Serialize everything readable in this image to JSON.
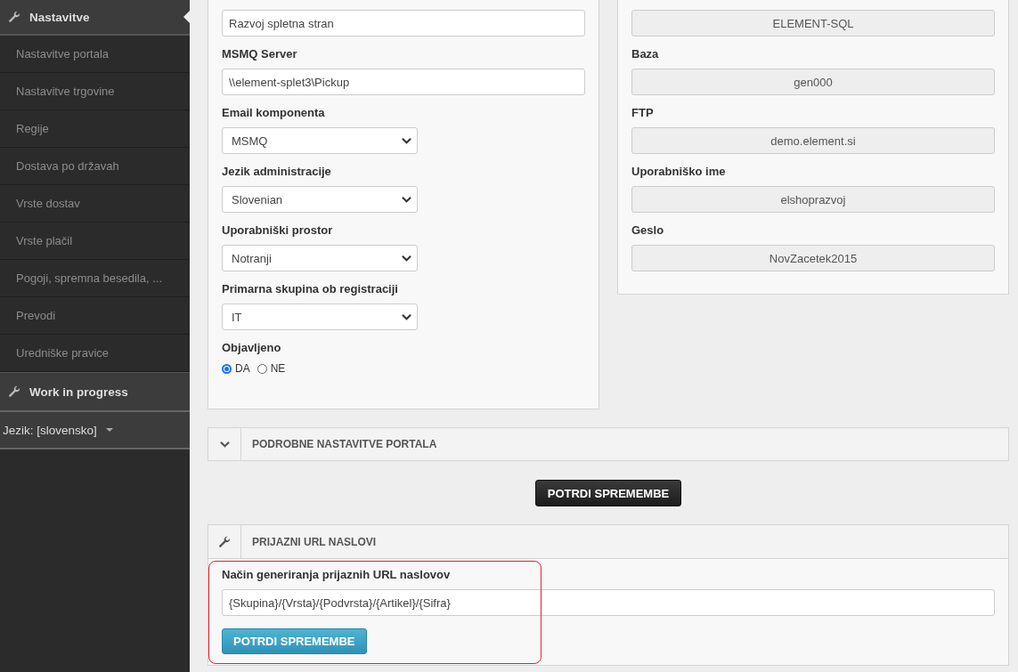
{
  "sidebar": {
    "header": {
      "label": "Nastavitve"
    },
    "items": [
      {
        "label": "Nastavitve portala"
      },
      {
        "label": "Nastavitve trgovine"
      },
      {
        "label": "Regije"
      },
      {
        "label": "Dostava po državah"
      },
      {
        "label": "Vrste dostav"
      },
      {
        "label": "Vrste plačil"
      },
      {
        "label": "Pogoji, spremna besedila, ..."
      },
      {
        "label": "Prevodi"
      },
      {
        "label": "Uredniške pravice"
      }
    ],
    "section": {
      "label": "Work in progress"
    },
    "language": {
      "label": "Jezik: [slovensko]"
    }
  },
  "left_panel": {
    "fields": [
      {
        "kind": "input",
        "value": "Razvoj spletna stran"
      },
      {
        "kind": "input",
        "label": "MSMQ Server",
        "value": "\\\\element-splet3\\Pickup"
      },
      {
        "kind": "select",
        "label": "Email komponenta",
        "value": "MSMQ"
      },
      {
        "kind": "select",
        "label": "Jezik administracije",
        "value": "Slovenian"
      },
      {
        "kind": "select",
        "label": "Uporabniški prostor",
        "value": "Notranji"
      },
      {
        "kind": "select",
        "label": "Primarna skupina ob registraciji",
        "value": "IT"
      },
      {
        "kind": "radio",
        "label": "Objavljeno",
        "options": [
          {
            "label": "DA",
            "selected": true
          },
          {
            "label": "NE",
            "selected": false
          }
        ]
      }
    ]
  },
  "right_panel": {
    "fields": [
      {
        "value": "ELEMENT-SQL"
      },
      {
        "label": "Baza",
        "value": "gen000"
      },
      {
        "label": "FTP",
        "value": "demo.element.si"
      },
      {
        "label": "Uporabniško ime",
        "value": "elshoprazvoj"
      },
      {
        "label": "Geslo",
        "value": "NovZacetek2015"
      }
    ]
  },
  "details_section": {
    "title": "PODROBNE NASTAVITVE PORTALA",
    "expanded": false
  },
  "confirm_button": "POTRDI SPREMEMBE",
  "url_section": {
    "title": "PRIJAZNI URL NASLOVI",
    "label": "Način generiranja prijaznih URL naslovov",
    "value": "{Skupina}/{Vrsta}/{Podvrsta}/{Artikel}/{Sifra}",
    "button": "POTRDI SPREMEMBE"
  }
}
